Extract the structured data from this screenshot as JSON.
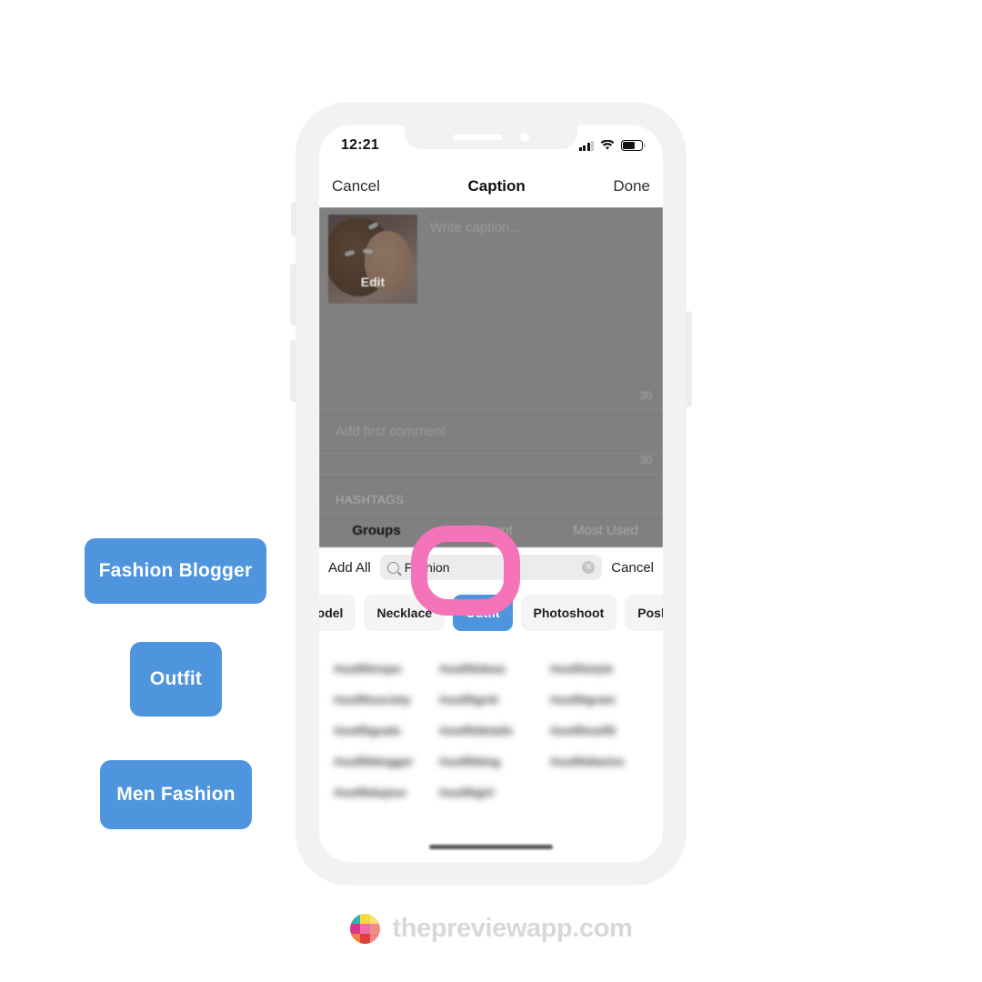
{
  "phone": {
    "status_bar": {
      "time": "12:21",
      "signal_icon": "cellular-bars-icon",
      "wifi_icon": "wifi-icon",
      "battery_icon": "battery-icon"
    },
    "nav_bar": {
      "cancel_label": "Cancel",
      "title": "Caption",
      "done_label": "Done"
    },
    "caption_editor": {
      "photo_edit_label": "Edit",
      "caption_placeholder": "Write caption...",
      "caption_counter": "30",
      "first_comment_placeholder": "Add first comment",
      "first_comment_counter": "30",
      "section_label": "HASHTAGS"
    },
    "tabs": [
      {
        "label": "Groups",
        "active": true
      },
      {
        "label": "Recent",
        "active": false
      },
      {
        "label": "Most Used",
        "active": false
      }
    ],
    "search_bar": {
      "add_all_label": "Add All",
      "search_icon": "search-icon",
      "search_value": "Fashion",
      "clear_icon": "clear-circle-icon",
      "cancel_label": "Cancel"
    },
    "group_chips": [
      {
        "label": "Model",
        "selected": false,
        "clipped": true
      },
      {
        "label": "Necklace",
        "selected": false,
        "clipped": false
      },
      {
        "label": "Outfit",
        "selected": true,
        "clipped": false
      },
      {
        "label": "Photoshoot",
        "selected": false,
        "clipped": false
      },
      {
        "label": "Poshmark",
        "selected": false,
        "clipped": false
      }
    ],
    "hashtag_grid_rows": [
      [
        "#outfitinspo",
        "#outfitideas",
        "#outfitstyle"
      ],
      [
        "#outfitsociety",
        "#outfitgrid",
        "#outfitgram"
      ],
      [
        "#outfitgoals",
        "#outfitdetails",
        "#outfitoutfit"
      ],
      [
        "#outfitblogger",
        "#outfitblog",
        "#outfitdiaries"
      ],
      [
        "#outfitdujour",
        "#outfitgirl",
        ""
      ]
    ],
    "home_indicator": "home-indicator"
  },
  "callouts": [
    {
      "label": "Fashion Blogger"
    },
    {
      "label": "Outfit"
    },
    {
      "label": "Men Fashion"
    }
  ],
  "highlight": {
    "target_label": "Outfit",
    "ring_color": "#f573b8"
  },
  "footer": {
    "logo_name": "preview-app-logo",
    "text": "thepreviewapp.com",
    "logo_colors": [
      "#31b3a8",
      "#f2d93c",
      "#f5e07a",
      "#d6378e",
      "#ef6ea8",
      "#f28b87",
      "#ef8240",
      "#e0403c",
      "#f0847e"
    ]
  },
  "theme": {
    "accent_blue": "#4e95dd",
    "highlight_pink": "#f573b8",
    "frame_gray": "#f2f2f2",
    "footer_gray": "#d8d8d8"
  }
}
